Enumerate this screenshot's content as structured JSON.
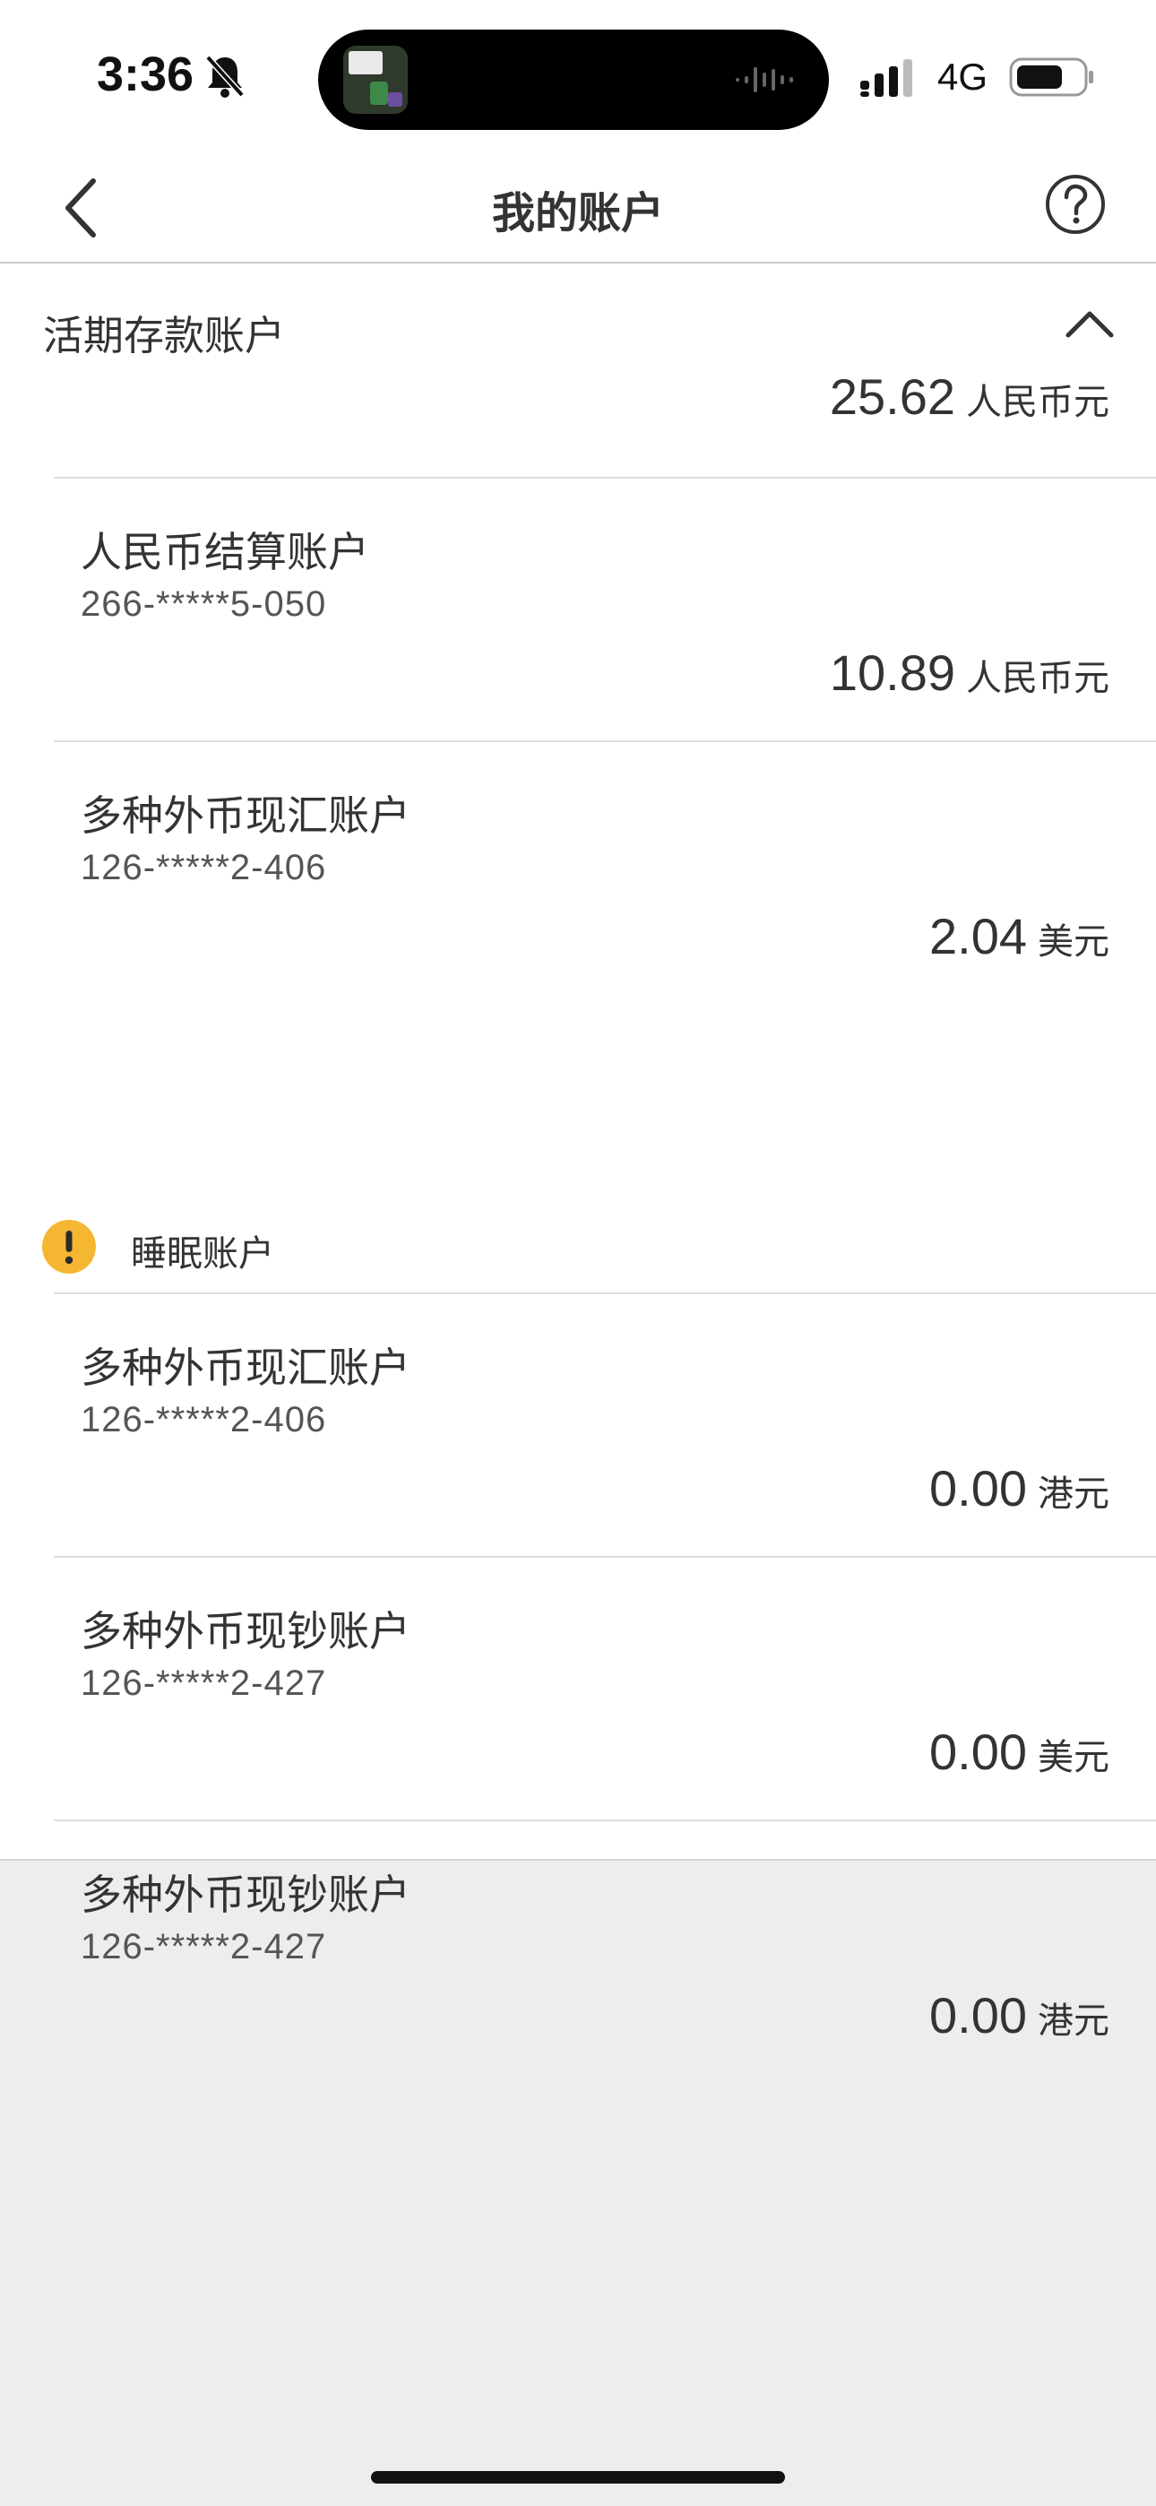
{
  "status_bar": {
    "time": "3:36",
    "network": "4G",
    "icons": [
      "bell-off-icon",
      "signal-icon",
      "battery-icon"
    ]
  },
  "nav": {
    "title": "我的账户",
    "back_icon": "chevron-left-icon",
    "help_icon": "question-circle-icon"
  },
  "section": {
    "title": "活期存款账户",
    "total": "25.62",
    "currency": "人民币元",
    "toggle_icon": "chevron-up-icon"
  },
  "accounts": [
    {
      "name": "人民币结算账户",
      "number": "266-*****5-050",
      "amount": "10.89",
      "currency": "人民币元"
    },
    {
      "name": "多种外币现汇账户",
      "number": "126-*****2-406",
      "amount": "2.04",
      "currency": "美元"
    },
    {
      "name": "多种外币现汇账户",
      "number": "126-*****2-406",
      "amount": "0.00",
      "currency": "港元"
    },
    {
      "name": "多种外币现钞账户",
      "number": "126-*****2-427",
      "amount": "0.00",
      "currency": "美元"
    },
    {
      "name": "多种外币现钞账户",
      "number": "126-*****2-427",
      "amount": "0.00",
      "currency": "港元"
    }
  ],
  "dormant": {
    "label": "睡眠账户",
    "icon": "warning-icon"
  },
  "colors": {
    "warning": "#f5b731",
    "text": "#333333",
    "background": "#ededed"
  }
}
